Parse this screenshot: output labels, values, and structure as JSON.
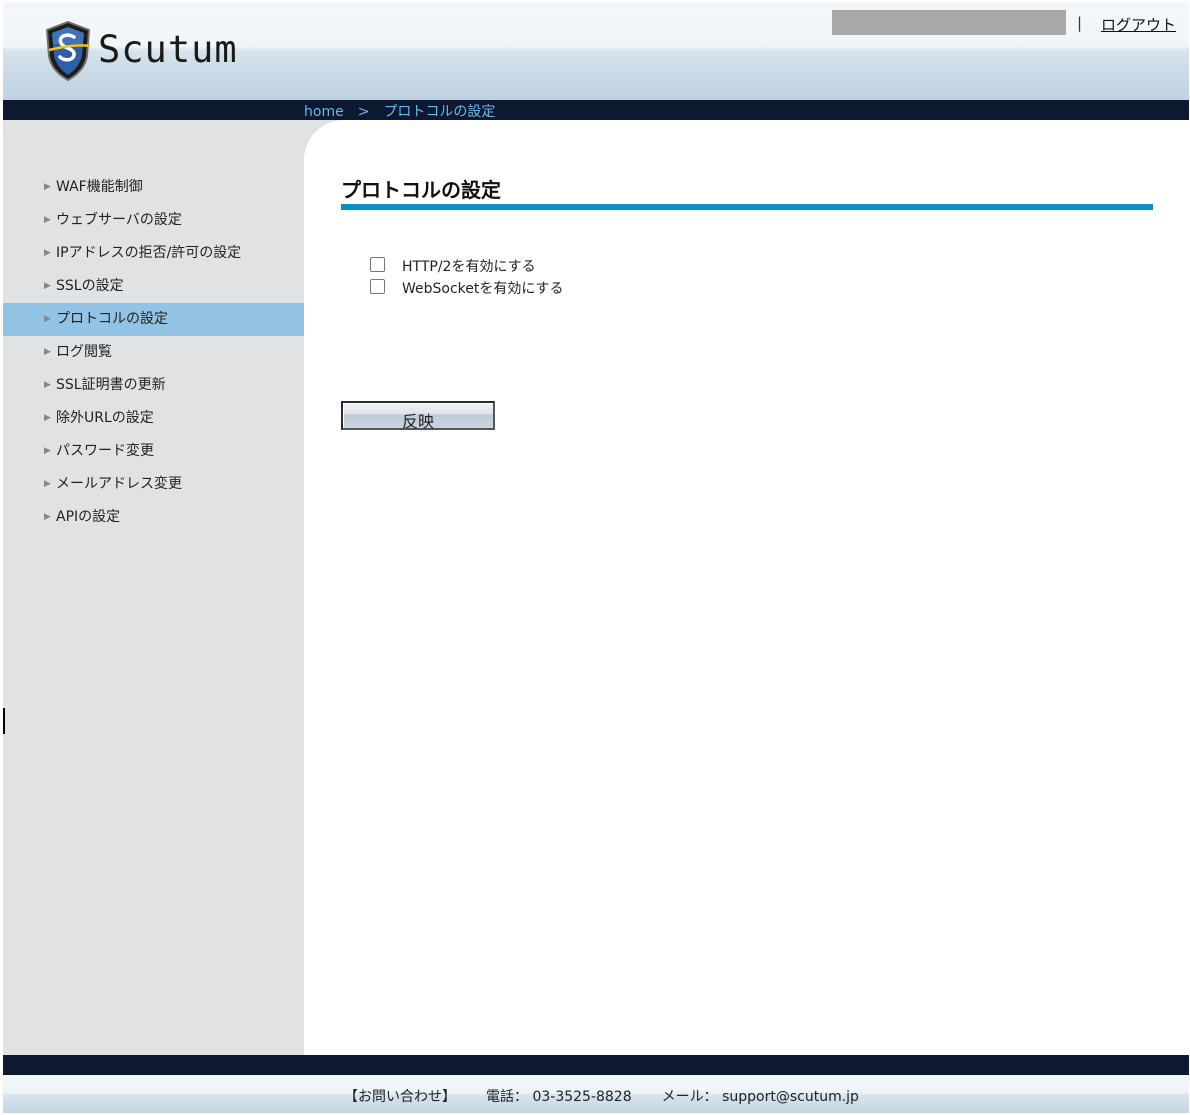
{
  "header": {
    "logo_text": "Scutum",
    "separator": "|",
    "logout_label": "ログアウト"
  },
  "breadcrumb": {
    "home": "home",
    "separator": ">",
    "current": "プロトコルの設定"
  },
  "sidebar": {
    "items": [
      {
        "label": "WAF機能制御",
        "active": false
      },
      {
        "label": "ウェブサーバの設定",
        "active": false
      },
      {
        "label": "IPアドレスの拒否/許可の設定",
        "active": false
      },
      {
        "label": "SSLの設定",
        "active": false
      },
      {
        "label": "プロトコルの設定",
        "active": true
      },
      {
        "label": "ログ閲覧",
        "active": false
      },
      {
        "label": "SSL証明書の更新",
        "active": false
      },
      {
        "label": "除外URLの設定",
        "active": false
      },
      {
        "label": "パスワード変更",
        "active": false
      },
      {
        "label": "メールアドレス変更",
        "active": false
      },
      {
        "label": "APIの設定",
        "active": false
      }
    ],
    "arrow_glyph": "▶"
  },
  "main": {
    "title": "プロトコルの設定",
    "options": [
      {
        "label": "HTTP/2を有効にする",
        "checked": false
      },
      {
        "label": "WebSocketを有効にする",
        "checked": false
      }
    ],
    "apply_label": "反映"
  },
  "footer": {
    "contact": "【お問い合わせ】",
    "phone": "電話： 03-3525-8828",
    "mail": "メール： support@scutum.jp"
  },
  "colors": {
    "nav_dark": "#0c1930",
    "breadcrumb_link": "#6cb7ea",
    "sidebar_bg": "#e1e2e4",
    "active_item": "#93c3e4",
    "title_rule": "#0b8fc8"
  }
}
